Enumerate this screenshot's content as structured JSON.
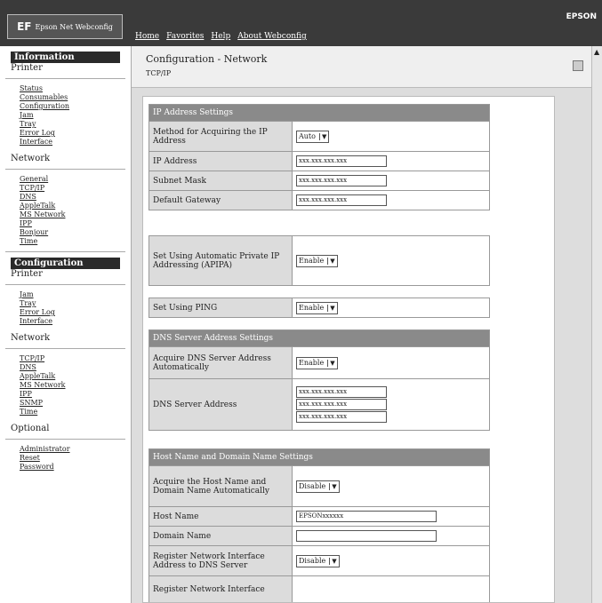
{
  "header": {
    "logo_mark": "EF",
    "logo_text": "Epson Net Webconfig",
    "brand": "EPSON",
    "nav": [
      "Home",
      "Favorites",
      "Help",
      "About Webconfig"
    ]
  },
  "left": {
    "information": {
      "header": "Information",
      "sub": "Printer",
      "items": [
        "Status",
        "Consumables",
        "Configuration",
        "Jam",
        "Tray",
        "Error Log",
        "Interface"
      ]
    },
    "network1": {
      "label": "Network",
      "items": [
        "General",
        "TCP/IP",
        "DNS",
        "AppleTalk",
        "MS Network",
        "IPP",
        "Bonjour",
        "Time"
      ]
    },
    "configuration": {
      "header": "Configuration",
      "sub": "Printer",
      "items": [
        "Jam",
        "Tray",
        "Error Log",
        "Interface"
      ]
    },
    "network2": {
      "label": "Network",
      "items": [
        "TCP/IP",
        "DNS",
        "AppleTalk",
        "MS Network",
        "IPP",
        "SNMP",
        "Time"
      ]
    },
    "optional": {
      "label": "Optional",
      "items": [
        "Administrator",
        "Reset",
        "Password"
      ]
    }
  },
  "page": {
    "title": "Configuration - Network",
    "subtitle": "TCP/IP"
  },
  "ip_section": {
    "title": "IP Address Settings",
    "method_label": "Method for Acquiring the IP Address",
    "method_value": "Auto",
    "ip_label": "IP Address",
    "ip_value": "xxx.xxx.xxx.xxx",
    "mask_label": "Subnet Mask",
    "mask_value": "xxx.xxx.xxx.xxx",
    "gateway_label": "Default Gateway",
    "gateway_value": "xxx.xxx.xxx.xxx"
  },
  "apipa": {
    "label": "Set Using Automatic Private IP Addressing (APIPA)",
    "value": "Enable"
  },
  "ping": {
    "label": "Set Using PING",
    "value": "Enable"
  },
  "dns": {
    "title": "DNS Server Address Settings",
    "acquire_label": "Acquire DNS Server Address Automatically",
    "acquire_value": "Enable",
    "server_label": "DNS Server Address",
    "server_values": [
      "xxx.xxx.xxx.xxx",
      "xxx.xxx.xxx.xxx",
      "xxx.xxx.xxx.xxx"
    ]
  },
  "host": {
    "title": "Host Name and Domain Name Settings",
    "acquire_label": "Acquire the Host Name and Domain Name Automatically",
    "acquire_value": "Disable",
    "host_label": "Host Name",
    "host_value": "EPSONxxxxxx",
    "domain_label": "Domain Name",
    "domain_value": "",
    "register_label": "Register Network Interface Address to DNS Server",
    "register_value": "Disable",
    "register2_label": "Register Network Interface"
  }
}
